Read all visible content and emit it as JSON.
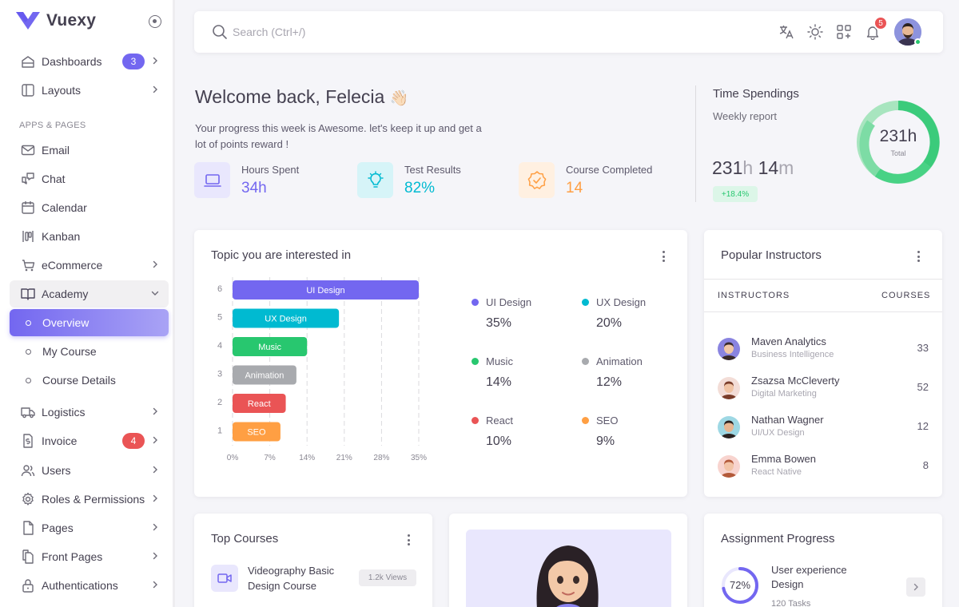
{
  "brand": {
    "name": "Vuexy",
    "color": "#7367f0"
  },
  "sidebar": {
    "section_apps": "APPS & PAGES",
    "items": [
      {
        "label": "Dashboards",
        "icon": "home-icon",
        "badge": "3"
      },
      {
        "label": "Layouts",
        "icon": "layout-icon"
      },
      {
        "label": "Email",
        "icon": "mail-icon"
      },
      {
        "label": "Chat",
        "icon": "chat-icon"
      },
      {
        "label": "Calendar",
        "icon": "calendar-icon"
      },
      {
        "label": "Kanban",
        "icon": "kanban-icon"
      },
      {
        "label": "eCommerce",
        "icon": "cart-icon"
      },
      {
        "label": "Academy",
        "icon": "book-icon"
      },
      {
        "label": "Overview",
        "icon": "circle-icon"
      },
      {
        "label": "My Course",
        "icon": "circle-icon"
      },
      {
        "label": "Course Details",
        "icon": "circle-icon"
      },
      {
        "label": "Logistics",
        "icon": "truck-icon"
      },
      {
        "label": "Invoice",
        "icon": "invoice-icon",
        "badge": "4"
      },
      {
        "label": "Users",
        "icon": "users-icon"
      },
      {
        "label": "Roles & Permissions",
        "icon": "settings-icon"
      },
      {
        "label": "Pages",
        "icon": "file-icon"
      },
      {
        "label": "Front Pages",
        "icon": "files-icon"
      },
      {
        "label": "Authentications",
        "icon": "lock-icon"
      }
    ]
  },
  "navbar": {
    "search_placeholder": "Search (Ctrl+/)",
    "notifications": "5"
  },
  "welcome": {
    "title": "Welcome back, Felecia",
    "emoji": "👋🏻",
    "subtitle": "Your progress this week is Awesome. let's keep it up and get a lot of points reward !",
    "stats": [
      {
        "label": "Hours Spent",
        "value": "34h",
        "color": "#7367f0"
      },
      {
        "label": "Test Results",
        "value": "82%",
        "color": "#00bad1"
      },
      {
        "label": "Course Completed",
        "value": "14",
        "color": "#ff9f43"
      }
    ]
  },
  "time_spendings": {
    "title": "Time Spendings",
    "subtitle": "Weekly report",
    "hours": "231",
    "hours_unit": "h",
    "minutes": "14",
    "minutes_unit": "m",
    "change": "+18.4%",
    "total": "231h",
    "total_label": "Total"
  },
  "topics": {
    "title": "Topic you are interested in",
    "legend": [
      {
        "name": "UI Design",
        "value": "35%",
        "color": "#7367f0"
      },
      {
        "name": "UX Design",
        "value": "20%",
        "color": "#00bad1"
      },
      {
        "name": "Music",
        "value": "14%",
        "color": "#28c76f"
      },
      {
        "name": "Animation",
        "value": "12%",
        "color": "#a8aaae"
      },
      {
        "name": "React",
        "value": "10%",
        "color": "#ea5455"
      },
      {
        "name": "SEO",
        "value": "9%",
        "color": "#ff9f43"
      }
    ]
  },
  "chart_data": {
    "type": "bar",
    "orientation": "horizontal",
    "categories": [
      "UI Design",
      "UX Design",
      "Music",
      "Animation",
      "React",
      "SEO"
    ],
    "row_labels": [
      "6",
      "5",
      "4",
      "3",
      "2",
      "1"
    ],
    "values": [
      35,
      20,
      14,
      12,
      10,
      9
    ],
    "colors": [
      "#7367f0",
      "#00bad1",
      "#28c76f",
      "#a8aaae",
      "#ea5455",
      "#ff9f43"
    ],
    "xticks": [
      "0%",
      "7%",
      "14%",
      "21%",
      "28%",
      "35%"
    ],
    "xlim": [
      0,
      35
    ],
    "grid": "vertical dashed"
  },
  "instructors": {
    "title": "Popular Instructors",
    "col_instructors": "INSTRUCTORS",
    "col_courses": "COURSES",
    "rows": [
      {
        "name": "Maven Analytics",
        "role": "Business Intelligence",
        "courses": "33"
      },
      {
        "name": "Zsazsa McCleverty",
        "role": "Digital Marketing",
        "courses": "52"
      },
      {
        "name": "Nathan Wagner",
        "role": "UI/UX Design",
        "courses": "12"
      },
      {
        "name": "Emma Bowen",
        "role": "React Native",
        "courses": "8"
      }
    ]
  },
  "top_courses": {
    "title": "Top Courses",
    "items": [
      {
        "title": "Videography Basic Design Course",
        "views": "1.2k Views"
      }
    ]
  },
  "assignment": {
    "title": "Assignment Progress",
    "items": [
      {
        "title": "User experience Design",
        "percent": "72%",
        "tasks": "120 Tasks",
        "progress": 0.72
      }
    ]
  }
}
